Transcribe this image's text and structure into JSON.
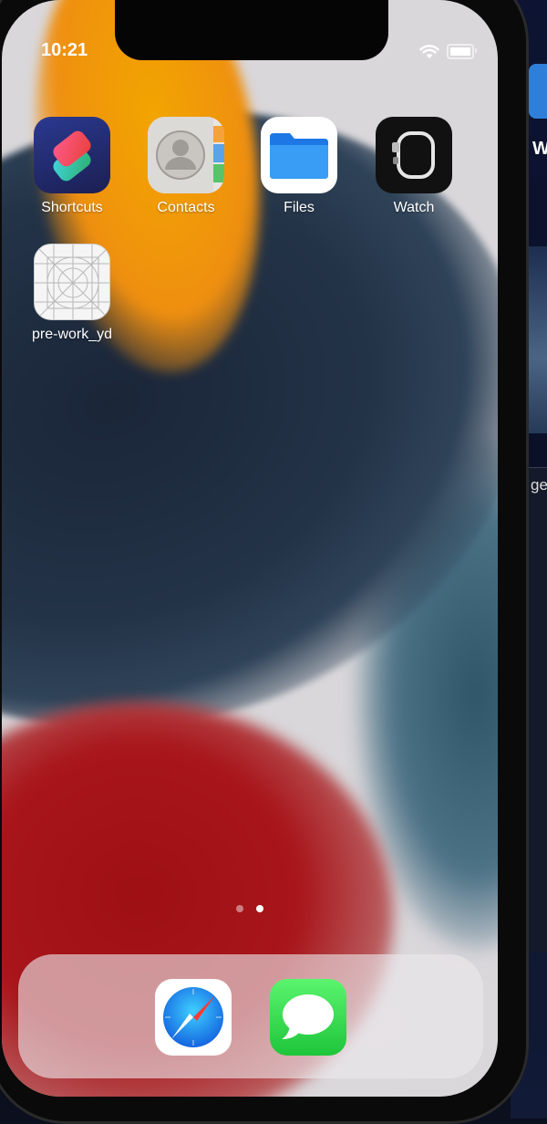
{
  "status_bar": {
    "time": "10:21",
    "icons": [
      "wifi-icon",
      "battery-icon"
    ]
  },
  "home_screen": {
    "apps": [
      {
        "name": "Shortcuts",
        "icon": "shortcuts-icon"
      },
      {
        "name": "Contacts",
        "icon": "contacts-icon"
      },
      {
        "name": "Files",
        "icon": "files-icon"
      },
      {
        "name": "Watch",
        "icon": "watch-icon"
      },
      {
        "name": "pre-work_yd",
        "icon": "app-placeholder-icon"
      }
    ],
    "page_indicator": {
      "pages": 2,
      "current": 2
    }
  },
  "dock": {
    "apps": [
      {
        "name": "Safari",
        "icon": "safari-icon"
      },
      {
        "name": "Messages",
        "icon": "messages-icon"
      }
    ]
  },
  "background_window": {
    "partial_letter": "W",
    "partial_text": "ge("
  },
  "colors": {
    "wallpaper_orange": "#f2a500",
    "wallpaper_navy": "#1a2538",
    "wallpaper_red": "#9e0f14",
    "files_blue": "#2a8cf0",
    "messages_green": "#1ec53a"
  }
}
